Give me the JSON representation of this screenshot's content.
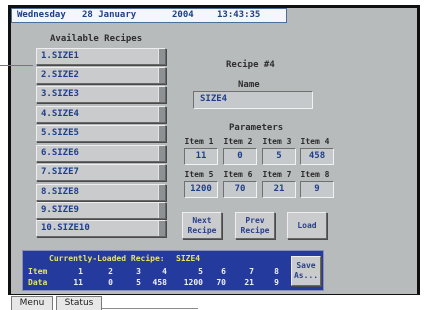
{
  "header": {
    "day": "Wednesday",
    "date": "28 January",
    "year": "2004",
    "time": "13:43:35"
  },
  "recipes": {
    "title": "Available Recipes",
    "items": [
      "1.SIZE1",
      "2.SIZE2",
      "3.SIZE3",
      "4.SIZE4",
      "5.SIZE5",
      "6.SIZE6",
      "7.SIZE7",
      "8.SIZE8",
      "9.SIZE9",
      "10.SIZE10"
    ]
  },
  "recipe": {
    "title": "Recipe #4",
    "name_label": "Name",
    "name_value": "SIZE4",
    "params_label": "Parameters"
  },
  "params": {
    "headers": [
      "Item 1",
      "Item 2",
      "Item 3",
      "Item 4",
      "Item 5",
      "Item 6",
      "Item 7",
      "Item 8"
    ],
    "values": [
      "11",
      "0",
      "5",
      "458",
      "1200",
      "70",
      "21",
      "9"
    ]
  },
  "buttons": {
    "next_l1": "Next",
    "next_l2": "Recipe",
    "prev_l1": "Prev",
    "prev_l2": "Recipe",
    "load": "Load",
    "save_l1": "Save",
    "save_l2": "As..."
  },
  "status": {
    "title": "Currently-Loaded Recipe:",
    "value": "SIZE4",
    "item_label": "Item",
    "data_label": "Data",
    "items": [
      "1",
      "2",
      "3",
      "4",
      "5",
      "6",
      "7",
      "8"
    ],
    "data": [
      "11",
      "0",
      "5",
      "458",
      "1200",
      "70",
      "21",
      "9"
    ]
  },
  "tabs": [
    "Menu",
    "Status"
  ]
}
